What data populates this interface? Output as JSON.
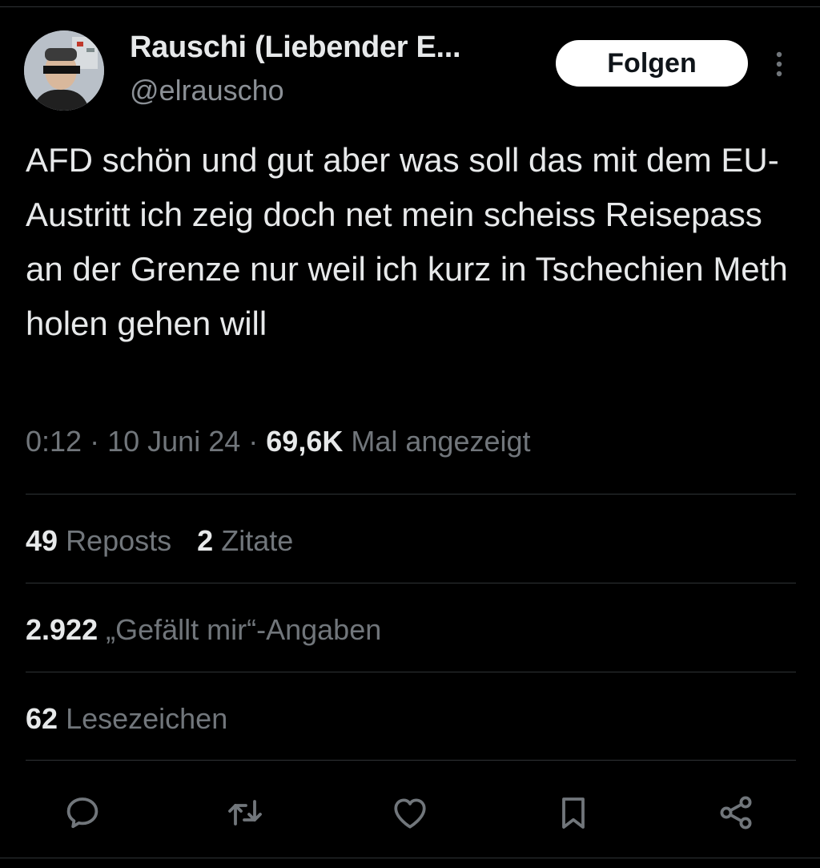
{
  "author": {
    "display_name": "Rauschi (Liebender E...",
    "handle": "@elrauscho"
  },
  "follow_button_label": "Folgen",
  "tweet_text": "AFD schön und gut aber was soll das mit dem EU-Austritt ich zeig doch net mein scheiss Reisepass an der Grenze nur weil ich kurz in Tschechien Meth holen gehen will",
  "meta": {
    "time": "0:12",
    "separator": "·",
    "date": "10 Juni 24",
    "views_count": "69,6K",
    "views_label": "Mal angezeigt"
  },
  "stats": {
    "reposts_count": "49",
    "reposts_label": "Reposts",
    "quotes_count": "2",
    "quotes_label": "Zitate",
    "likes_count": "2.922",
    "likes_label": "„Gefällt mir“-Angaben",
    "bookmarks_count": "62",
    "bookmarks_label": "Lesezeichen"
  },
  "colors": {
    "background": "#000000",
    "text_primary": "#e7e9ea",
    "text_secondary": "#71767b",
    "divider": "#2f3336",
    "follow_bg": "#ffffff"
  },
  "icons": [
    "more-vertical-icon",
    "reply-icon",
    "repost-icon",
    "like-icon",
    "bookmark-icon",
    "share-icon"
  ]
}
